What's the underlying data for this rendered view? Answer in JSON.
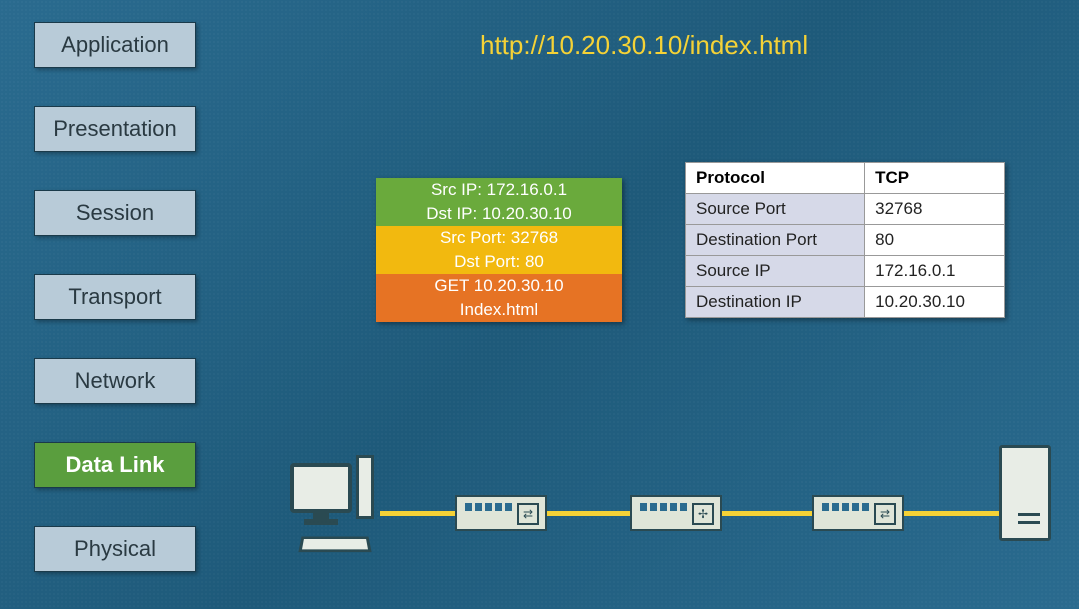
{
  "url": "http://10.20.30.10/index.html",
  "layers": [
    {
      "label": "Application",
      "active": false
    },
    {
      "label": "Presentation",
      "active": false
    },
    {
      "label": "Session",
      "active": false
    },
    {
      "label": "Transport",
      "active": false
    },
    {
      "label": "Network",
      "active": false
    },
    {
      "label": "Data Link",
      "active": true
    },
    {
      "label": "Physical",
      "active": false
    }
  ],
  "packet": {
    "network": {
      "src": "Src IP: 172.16.0.1",
      "dst": "Dst IP: 10.20.30.10"
    },
    "transport": {
      "src": "Src Port: 32768",
      "dst": "Dst Port: 80"
    },
    "application": {
      "line1": "GET 10.20.30.10",
      "line2": "Index.html"
    }
  },
  "table": {
    "header": {
      "k": "Protocol",
      "v": "TCP"
    },
    "rows": [
      {
        "k": "Source Port",
        "v": "32768"
      },
      {
        "k": "Destination Port",
        "v": "80"
      },
      {
        "k": "Source IP",
        "v": "172.16.0.1"
      },
      {
        "k": "Destination IP",
        "v": "10.20.30.10"
      }
    ]
  },
  "devices": {
    "pc": "workstation",
    "switch1": "switch",
    "switch2": "switch-router",
    "switch3": "switch",
    "server": "server"
  }
}
